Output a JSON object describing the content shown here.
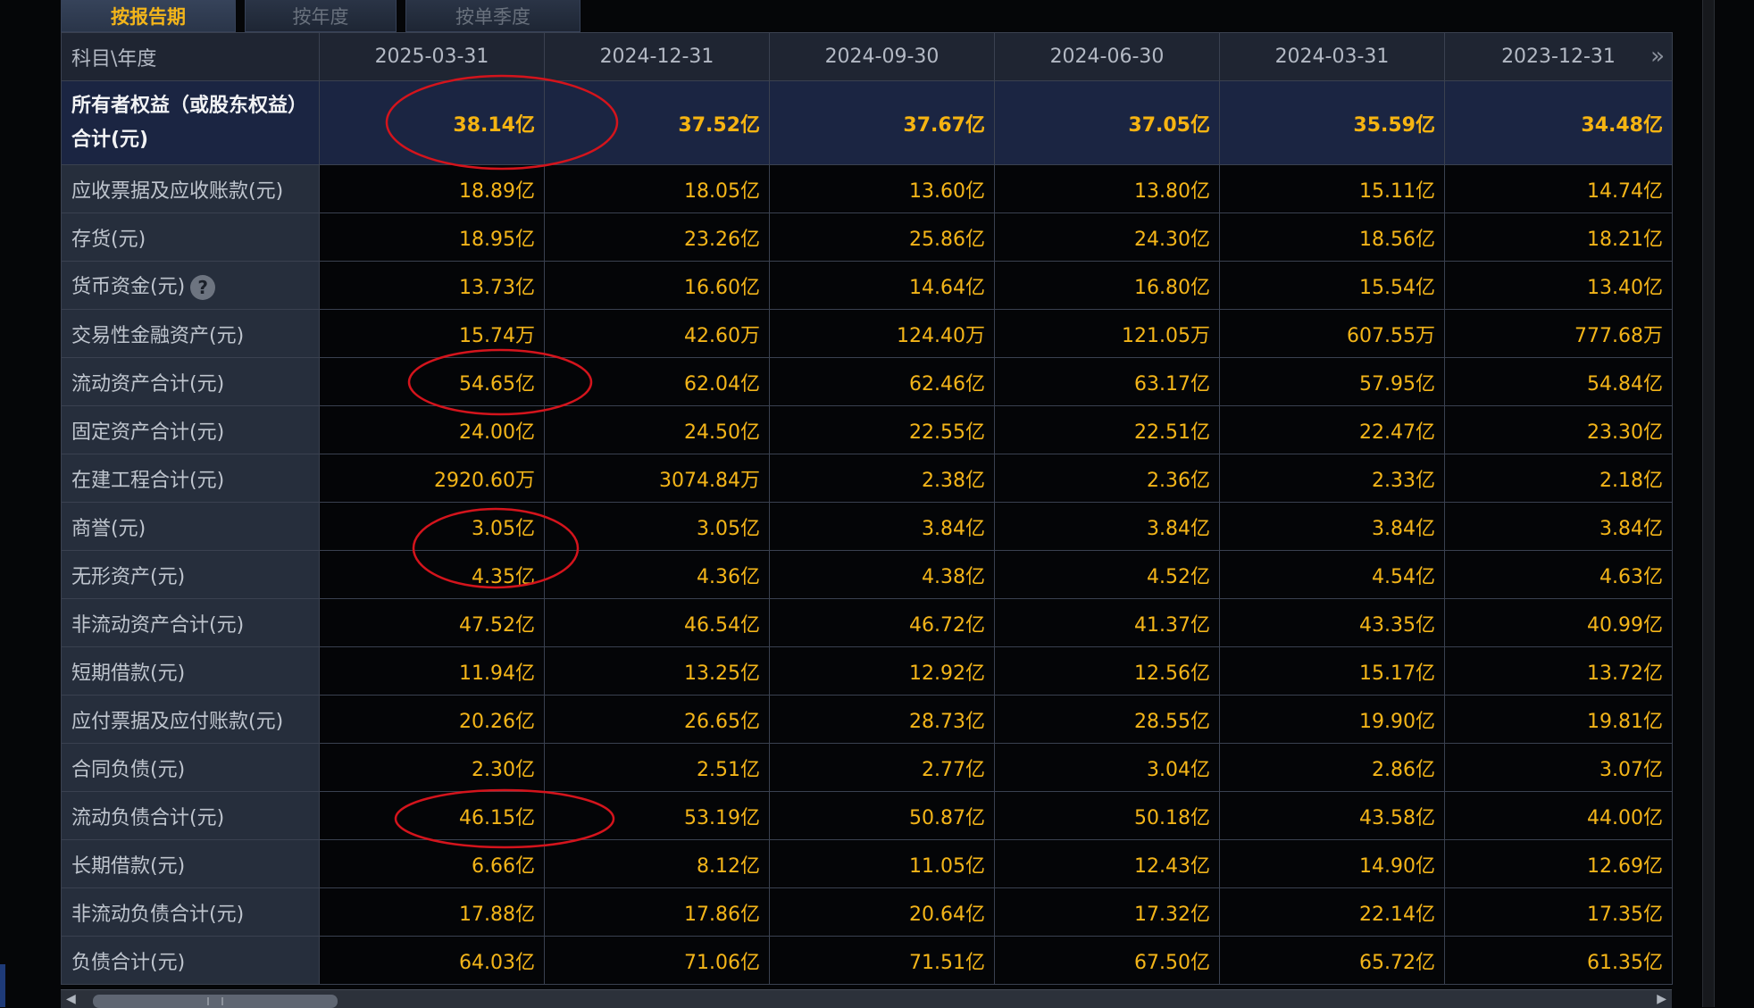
{
  "tabs": [
    {
      "label": "按报告期",
      "active": true
    },
    {
      "label": "按年度",
      "active": false
    },
    {
      "label": "按单季度",
      "active": false
    }
  ],
  "header": {
    "corner": "科目\\年度",
    "columns": [
      "2025-03-31",
      "2024-12-31",
      "2024-09-30",
      "2024-06-30",
      "2024-03-31",
      "2023-12-31"
    ],
    "next_icon": "double-chevron-right-icon"
  },
  "rows": [
    {
      "label": "所有者权益（或股东权益）合计(元)",
      "values": [
        "38.14亿",
        "37.52亿",
        "37.67亿",
        "37.05亿",
        "35.59亿",
        "34.48亿"
      ]
    },
    {
      "label": "应收票据及应收账款(元)",
      "values": [
        "18.89亿",
        "18.05亿",
        "13.60亿",
        "13.80亿",
        "15.11亿",
        "14.74亿"
      ]
    },
    {
      "label": "存货(元)",
      "values": [
        "18.95亿",
        "23.26亿",
        "25.86亿",
        "24.30亿",
        "18.56亿",
        "18.21亿"
      ]
    },
    {
      "label": "货币资金(元)",
      "help": "?",
      "values": [
        "13.73亿",
        "16.60亿",
        "14.64亿",
        "16.80亿",
        "15.54亿",
        "13.40亿"
      ]
    },
    {
      "label": "交易性金融资产(元)",
      "values": [
        "15.74万",
        "42.60万",
        "124.40万",
        "121.05万",
        "607.55万",
        "777.68万"
      ]
    },
    {
      "label": "流动资产合计(元)",
      "values": [
        "54.65亿",
        "62.04亿",
        "62.46亿",
        "63.17亿",
        "57.95亿",
        "54.84亿"
      ]
    },
    {
      "label": "固定资产合计(元)",
      "values": [
        "24.00亿",
        "24.50亿",
        "22.55亿",
        "22.51亿",
        "22.47亿",
        "23.30亿"
      ]
    },
    {
      "label": "在建工程合计(元)",
      "values": [
        "2920.60万",
        "3074.84万",
        "2.38亿",
        "2.36亿",
        "2.33亿",
        "2.18亿"
      ]
    },
    {
      "label": "商誉(元)",
      "values": [
        "3.05亿",
        "3.05亿",
        "3.84亿",
        "3.84亿",
        "3.84亿",
        "3.84亿"
      ]
    },
    {
      "label": "无形资产(元)",
      "values": [
        "4.35亿",
        "4.36亿",
        "4.38亿",
        "4.52亿",
        "4.54亿",
        "4.63亿"
      ]
    },
    {
      "label": "非流动资产合计(元)",
      "values": [
        "47.52亿",
        "46.54亿",
        "46.72亿",
        "41.37亿",
        "43.35亿",
        "40.99亿"
      ]
    },
    {
      "label": "短期借款(元)",
      "values": [
        "11.94亿",
        "13.25亿",
        "12.92亿",
        "12.56亿",
        "15.17亿",
        "13.72亿"
      ]
    },
    {
      "label": "应付票据及应付账款(元)",
      "values": [
        "20.26亿",
        "26.65亿",
        "28.73亿",
        "28.55亿",
        "19.90亿",
        "19.81亿"
      ]
    },
    {
      "label": "合同负债(元)",
      "values": [
        "2.30亿",
        "2.51亿",
        "2.77亿",
        "3.04亿",
        "2.86亿",
        "3.07亿"
      ]
    },
    {
      "label": "流动负债合计(元)",
      "values": [
        "46.15亿",
        "53.19亿",
        "50.87亿",
        "50.18亿",
        "43.58亿",
        "44.00亿"
      ]
    },
    {
      "label": "长期借款(元)",
      "values": [
        "6.66亿",
        "8.12亿",
        "11.05亿",
        "12.43亿",
        "14.90亿",
        "12.69亿"
      ]
    },
    {
      "label": "非流动负债合计(元)",
      "values": [
        "17.88亿",
        "17.86亿",
        "20.64亿",
        "17.32亿",
        "22.14亿",
        "17.35亿"
      ]
    },
    {
      "label": "负债合计(元)",
      "values": [
        "64.03亿",
        "71.06亿",
        "71.51亿",
        "67.50亿",
        "65.72亿",
        "61.35亿"
      ]
    }
  ],
  "colors": {
    "value_text": "#f4b519",
    "annotation": "#d4141c",
    "header_bg": "#1f2532",
    "highlight_bg": "#1b2542"
  }
}
